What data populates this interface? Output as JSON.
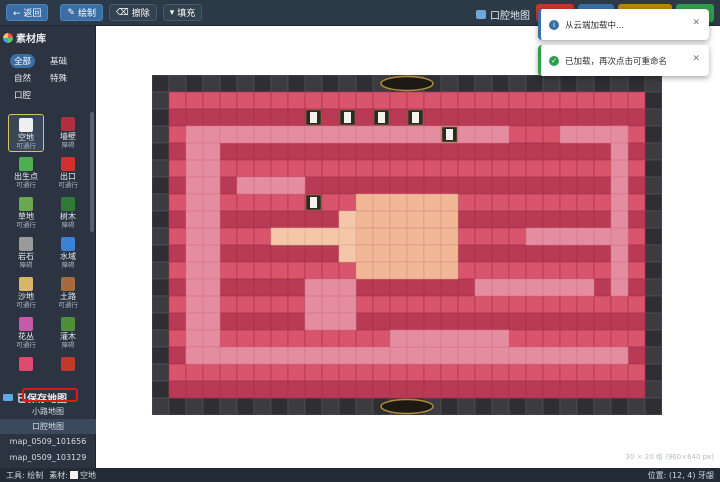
{
  "toolbar": {
    "back_label": "← 返回",
    "draw_label": "绘制",
    "erase_label": "擦除",
    "fill_label": "填充"
  },
  "map_title": "口腔地图",
  "sidebar": {
    "title": "素材库",
    "categories": [
      "全部",
      "基础",
      "自然",
      "特殊",
      "口腔"
    ],
    "tiles": [
      {
        "name": "空地",
        "pass": "可通行",
        "color": "#efeff2"
      },
      {
        "name": "墙壁",
        "pass": "障碍",
        "color": "#b03040"
      },
      {
        "name": "出生点",
        "pass": "可通行",
        "color": "#4caf50"
      },
      {
        "name": "出口",
        "pass": "可通行",
        "color": "#d23030"
      },
      {
        "name": "草地",
        "pass": "可通行",
        "color": "#6aa84f"
      },
      {
        "name": "树木",
        "pass": "障碍",
        "color": "#2f7a34"
      },
      {
        "name": "岩石",
        "pass": "障碍",
        "color": "#9a9a9a"
      },
      {
        "name": "水域",
        "pass": "障碍",
        "color": "#3b82d6"
      },
      {
        "name": "沙地",
        "pass": "可通行",
        "color": "#d9b56a"
      },
      {
        "name": "土路",
        "pass": "可通行",
        "color": "#a66b3c"
      },
      {
        "name": "花丛",
        "pass": "可通行",
        "color": "#c45aa8"
      },
      {
        "name": "灌木",
        "pass": "障碍",
        "color": "#4f8f3a"
      },
      {
        "name": "",
        "pass": "",
        "color": "#e04a70"
      },
      {
        "name": "",
        "pass": "",
        "color": "#c0392b"
      }
    ],
    "saved_title": "已保存地图",
    "saved_maps": [
      "小路地图",
      "口腔地图",
      "map_0509_101656",
      "map_0509_103129"
    ]
  },
  "toasts": [
    {
      "text": "从云端加载中...",
      "type": "info"
    },
    {
      "text": "已加载，再次点击可重命名",
      "type": "success"
    }
  ],
  "canvas_info": "30 × 20 格 (960×640 px)",
  "status": {
    "tool_label": "工具: 绘制",
    "material_label": "素材:",
    "material_value": "空地",
    "position_label": "位置: (12, 4) 牙龈"
  },
  "colors": {
    "accent": "#3a6ea5",
    "gum": "#d9546d",
    "gum_dark": "#b83a55",
    "floor_peach": "#f2b797",
    "selected_outline": "#e01818"
  }
}
